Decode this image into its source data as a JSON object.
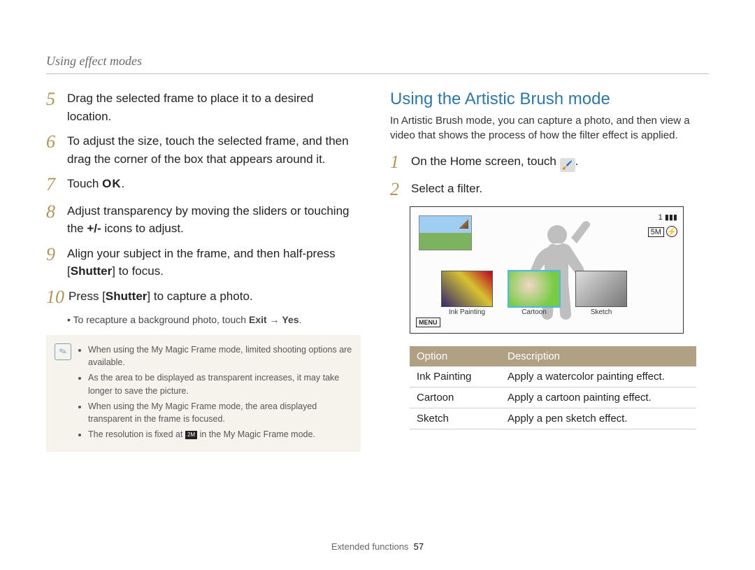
{
  "header": "Using effect modes",
  "left_steps": {
    "s5": {
      "n": "5",
      "text": "Drag the selected frame to place it to a desired location."
    },
    "s6": {
      "n": "6",
      "text": "To adjust the size, touch the selected frame, and then drag the corner of the box that appears around it."
    },
    "s7": {
      "n": "7",
      "pre": "Touch ",
      "ok": "OK",
      "post": "."
    },
    "s8": {
      "n": "8",
      "pre": "Adjust transparency by moving the sliders or touching the ",
      "bold": "+/-",
      "post": " icons to adjust."
    },
    "s9": {
      "n": "9",
      "pre": "Align your subject in the frame, and then half-press [",
      "bold": "Shutter",
      "post": "] to focus."
    },
    "s10": {
      "n": "10",
      "pre": "Press [",
      "bold": "Shutter",
      "post": "] to capture a photo."
    },
    "s10_sub": {
      "pre": "To recapture a background photo, touch ",
      "b1": "Exit",
      "arrow": " → ",
      "b2": "Yes",
      "post": "."
    }
  },
  "tips": [
    "When using the My Magic Frame mode, limited shooting options are available.",
    "As the area to be displayed as transparent increases, it may take longer to save the picture.",
    "When using the My Magic Frame mode, the area displayed transparent in the frame is focused.",
    {
      "pre": "The resolution is fixed at ",
      "icon": "2M",
      "post": " in the My Magic Frame mode."
    }
  ],
  "right": {
    "title": "Using the Artistic Brush mode",
    "intro": "In Artistic Brush mode, you can capture a photo, and then view a video that shows the process of how the filter effect is applied.",
    "s1": {
      "n": "1",
      "pre": "On the Home screen, touch ",
      "post": "."
    },
    "s2": {
      "n": "2",
      "text": "Select a filter."
    }
  },
  "lcd": {
    "counter": "1",
    "menu": "MENU",
    "res": "5M",
    "thumbs": [
      {
        "label": "Ink Painting"
      },
      {
        "label": "Cartoon"
      },
      {
        "label": "Sketch"
      }
    ]
  },
  "table": {
    "h1": "Option",
    "h2": "Description",
    "rows": [
      {
        "opt": "Ink Painting",
        "desc": "Apply a watercolor painting effect."
      },
      {
        "opt": "Cartoon",
        "desc": "Apply a cartoon painting effect."
      },
      {
        "opt": "Sketch",
        "desc": "Apply a pen sketch effect."
      }
    ]
  },
  "footer": {
    "section": "Extended functions",
    "page": "57"
  }
}
